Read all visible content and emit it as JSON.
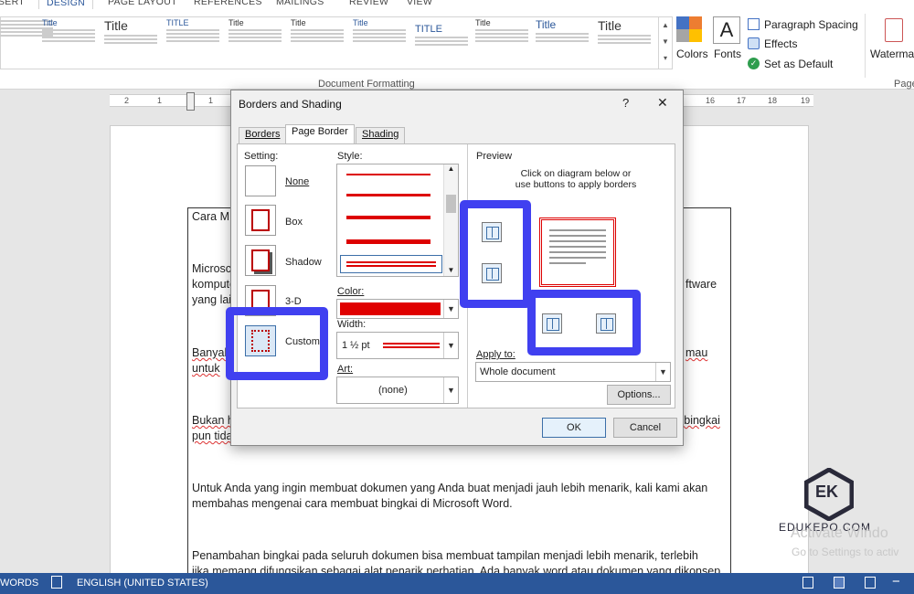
{
  "ribbon": {
    "tabs": [
      "SERT",
      "DESIGN",
      "PAGE LAYOUT",
      "REFERENCES",
      "MAILINGS",
      "REVIEW",
      "VIEW"
    ],
    "document_formatting_label": "Document Formatting",
    "gallery_titles": [
      "Title",
      "Title",
      "TITLE",
      "Title",
      "Title",
      "Title",
      "TITLE",
      "Title",
      "Title",
      "Title"
    ],
    "colors_label": "Colors",
    "fonts_label": "Fonts",
    "fonts_glyph": "A",
    "paragraph_spacing_label": "Paragraph Spacing",
    "effects_label": "Effects",
    "set_default_label": "Set as Default",
    "watermark_label": "Waterman",
    "page_label": "Page"
  },
  "ruler": {
    "left_numbers": [
      "2",
      "1",
      "1"
    ],
    "right_numbers": [
      "16",
      "17",
      "18",
      "19"
    ]
  },
  "document": {
    "line1": "Cara M",
    "line2": "Microsc",
    "line3": "kompute",
    "line3_right": "ftware",
    "line4": "yang lai",
    "line5": "Banyak",
    "line5_right": "mau",
    "line6": "untuk",
    "line7": "Bukan h",
    "line7_right": "i bingkai",
    "line8": "pun tida",
    "para2_line1": "Untuk Anda yang ingin membuat dokumen yang Anda buat menjadi jauh lebih menarik, kali kami akan",
    "para2_line2": "membahas mengenai cara membuat bingkai di Microsoft Word.",
    "para3_line1": "Penambahan bingkai pada seluruh dokumen bisa membuat tampilan menjadi lebih menarik, terlebih",
    "para3_line2": "jika memang difungsikan sebagai alat penarik perhatian. Ada banyak word atau dokumen yang dikonsep"
  },
  "dialog": {
    "title": "Borders and Shading",
    "help": "?",
    "close": "✕",
    "tabs": [
      "Borders",
      "Page Border",
      "Shading"
    ],
    "setting_label": "Setting:",
    "settings": [
      "None",
      "Box",
      "Shadow",
      "3-D",
      "Custom"
    ],
    "style_label": "Style:",
    "color_label": "Color:",
    "color_value": "#e00000",
    "width_label": "Width:",
    "width_value": "1 ½ pt",
    "art_label": "Art:",
    "art_value": "(none)",
    "preview_label": "Preview",
    "preview_hint_1": "Click on diagram below or",
    "preview_hint_2": "use buttons to apply borders",
    "apply_to_label": "Apply to:",
    "apply_to_value": "Whole document",
    "options_button": "Options...",
    "ok_button": "OK",
    "cancel_button": "Cancel",
    "highlight_color": "#4040f0"
  },
  "status": {
    "words": "WORDS",
    "language": "ENGLISH (UNITED STATES)"
  },
  "watermark": {
    "logo_text": "EK",
    "site": "EDUKEPO.COM",
    "activate_1": "Activate Windo",
    "activate_2": "Go to Settings to activ"
  }
}
